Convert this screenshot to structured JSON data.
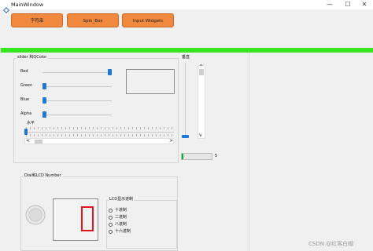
{
  "window": {
    "title": "MainWindow",
    "min_glyph": "—",
    "max_glyph": "☐",
    "close_glyph": "✕"
  },
  "toolbar": {
    "btn1": "字符串",
    "btn2": "Spin_Box",
    "btn3": "Input Widgets"
  },
  "slider_group": {
    "title": "slider 和QColor",
    "red_label": "Red",
    "green_label": "Green",
    "blue_label": "Blue",
    "alpha_label": "Alpha",
    "horizontal_title": "水平",
    "values": {
      "red": 1.0,
      "green": 0.0,
      "blue": 0.0,
      "alpha": 0.0
    }
  },
  "vertical_group": {
    "title": "垂直",
    "progress_value": "5"
  },
  "dial_group": {
    "title": "Dial和LCD Number",
    "lcd_value": "0"
  },
  "lcd_radix": {
    "title": "LCD显示进制",
    "options": [
      "十进制",
      "二进制",
      "八进制",
      "十六进制"
    ]
  },
  "scroll_arrows": {
    "up": "^",
    "down": "v",
    "left": "<",
    "right": ">"
  },
  "watermark": "CSDN @红客白帽",
  "colors": {
    "accent_button": "#f0883e",
    "green_bar": "#35e71d",
    "slider_handle": "#1e78d6",
    "lcd_digit": "#e0141e"
  }
}
